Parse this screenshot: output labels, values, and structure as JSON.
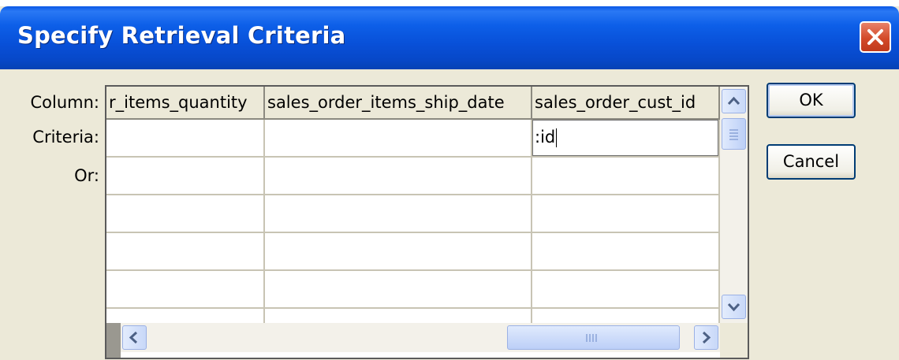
{
  "window": {
    "title": "Specify Retrieval Criteria"
  },
  "labels": {
    "column": "Column:",
    "criteria": "Criteria:",
    "or": "Or:"
  },
  "grid": {
    "columns": [
      "r_items_quantity",
      "sales_order_items_ship_date",
      "sales_order_cust_id"
    ],
    "criteria": [
      "",
      "",
      ":id"
    ]
  },
  "buttons": {
    "ok": "OK",
    "cancel": "Cancel"
  },
  "icons": {
    "close": "close-icon",
    "scroll_up": "chevron-up-icon",
    "scroll_down": "chevron-down-icon",
    "scroll_left": "chevron-left-icon",
    "scroll_right": "chevron-right-icon"
  },
  "colors": {
    "titlebar": "#0a58e6",
    "dialog_bg": "#ece9d8",
    "close_button": "#d34a2a"
  }
}
